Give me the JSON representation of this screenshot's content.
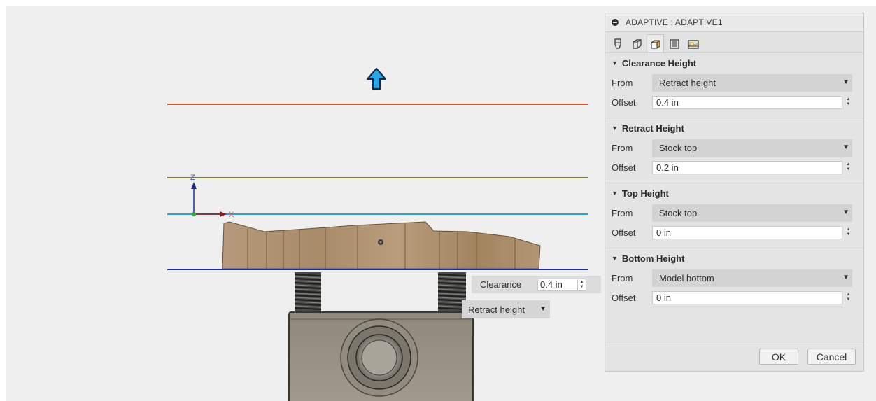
{
  "viewport": {
    "axis_z_label": "Z",
    "axis_x_label": "X",
    "line_colors": {
      "clearance": "#e0582a",
      "retract": "#7d7a34",
      "top": "#2f9ee4",
      "bottom": "#1d2fa8"
    },
    "clearance_popup": {
      "label": "Clearance",
      "value": "0.4 in"
    },
    "retract_popup": {
      "value": "Retract height"
    }
  },
  "dialog": {
    "title": "ADAPTIVE : ADAPTIVE1",
    "tabs": [
      {
        "icon": "tool-icon"
      },
      {
        "icon": "geometry-icon"
      },
      {
        "icon": "heights-icon",
        "active": true
      },
      {
        "icon": "passes-icon"
      },
      {
        "icon": "linking-icon"
      }
    ],
    "groups": [
      {
        "title": "Clearance Height",
        "from_label": "From",
        "from_value": "Retract height",
        "offset_label": "Offset",
        "offset_value": "0.4 in"
      },
      {
        "title": "Retract Height",
        "from_label": "From",
        "from_value": "Stock top",
        "offset_label": "Offset",
        "offset_value": "0.2 in"
      },
      {
        "title": "Top Height",
        "from_label": "From",
        "from_value": "Stock top",
        "offset_label": "Offset",
        "offset_value": "0 in"
      },
      {
        "title": "Bottom Height",
        "from_label": "From",
        "from_value": "Model bottom",
        "offset_label": "Offset",
        "offset_value": "0 in"
      }
    ],
    "ok_label": "OK",
    "cancel_label": "Cancel"
  }
}
